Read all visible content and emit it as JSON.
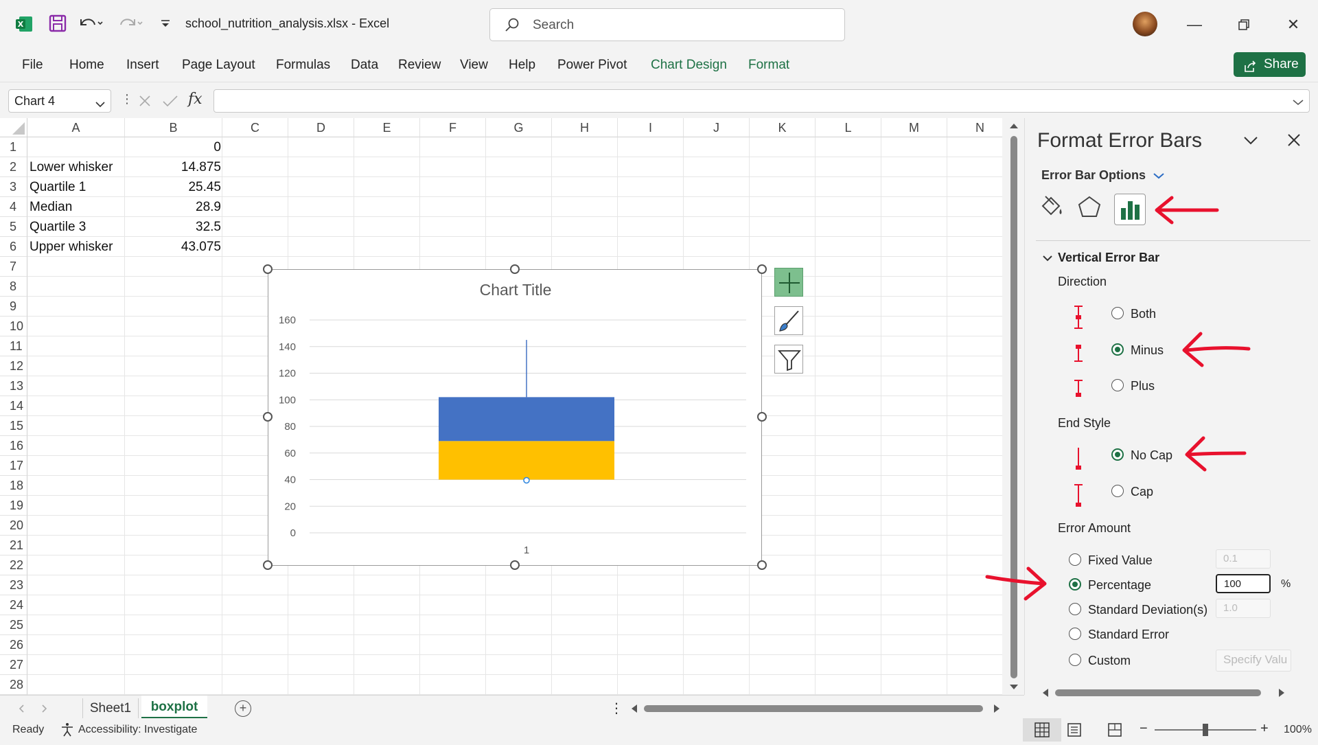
{
  "titlebar": {
    "filename": "school_nutrition_analysis.xlsx",
    "separator": "-",
    "app": "Excel",
    "search_placeholder": "Search"
  },
  "ribbon": {
    "tabs": [
      "File",
      "Home",
      "Insert",
      "Page Layout",
      "Formulas",
      "Data",
      "Review",
      "View",
      "Help",
      "Power Pivot",
      "Chart Design",
      "Format"
    ],
    "share_label": "Share"
  },
  "formula_bar": {
    "name_box": "Chart 4",
    "formula": ""
  },
  "sheet": {
    "columns": [
      "A",
      "B",
      "C",
      "D",
      "E",
      "F",
      "G",
      "H",
      "I",
      "J",
      "K",
      "L",
      "M",
      "N"
    ],
    "rows": [
      "1",
      "2",
      "3",
      "4",
      "5",
      "6",
      "7",
      "8",
      "9",
      "10",
      "11",
      "12",
      "13",
      "14",
      "15",
      "16",
      "17",
      "18",
      "19",
      "20",
      "21",
      "22",
      "23",
      "24",
      "25",
      "26",
      "27",
      "28"
    ],
    "data": [
      {
        "label": "",
        "value": "0"
      },
      {
        "label": "Lower whisker",
        "value": "14.875"
      },
      {
        "label": "Quartile 1",
        "value": "25.45"
      },
      {
        "label": "Median",
        "value": "28.9"
      },
      {
        "label": "Quartile 3",
        "value": "32.5"
      },
      {
        "label": "Upper whisker",
        "value": "43.075"
      }
    ]
  },
  "chart_data": {
    "type": "bar",
    "title": "Chart Title",
    "categories": [
      "1"
    ],
    "stacked": true,
    "series": [
      {
        "values": [
          40
        ],
        "color": "#ffffff"
      },
      {
        "values": [
          29
        ],
        "color": "#ffc000"
      },
      {
        "values": [
          33
        ],
        "color": "#4472c4"
      }
    ],
    "error_bar": {
      "from": 102,
      "to": 145,
      "color": "#4472c4"
    },
    "yticks": [
      0,
      20,
      40,
      60,
      80,
      100,
      120,
      140,
      160
    ],
    "ylim": [
      0,
      160
    ],
    "grid": true,
    "legend": "none"
  },
  "pane": {
    "title": "Format Error Bars",
    "options_label": "Error Bar Options",
    "section": "Vertical Error Bar",
    "direction_label": "Direction",
    "direction_options": [
      "Both",
      "Minus",
      "Plus"
    ],
    "direction_selected": "Minus",
    "end_style_label": "End Style",
    "end_style_options": [
      "No Cap",
      "Cap"
    ],
    "end_style_selected": "No Cap",
    "error_amount_label": "Error Amount",
    "amount_options": [
      "Fixed Value",
      "Percentage",
      "Standard Deviation(s)",
      "Standard Error",
      "Custom"
    ],
    "amount_selected": "Percentage",
    "fixed_value": "0.1",
    "percentage_value": "100",
    "percent_sign": "%",
    "stddev_value": "1.0",
    "specify_label": "Specify Valu"
  },
  "sheets": {
    "tabs": [
      "Sheet1",
      "boxplot"
    ],
    "active": "boxplot"
  },
  "status": {
    "ready": "Ready",
    "accessibility": "Accessibility: Investigate",
    "zoom": "100%"
  },
  "colors": {
    "accent_green": "#1e7145",
    "annotation_red": "#e8112d",
    "bar_blue": "#4472c4",
    "bar_gold": "#ffc000"
  }
}
